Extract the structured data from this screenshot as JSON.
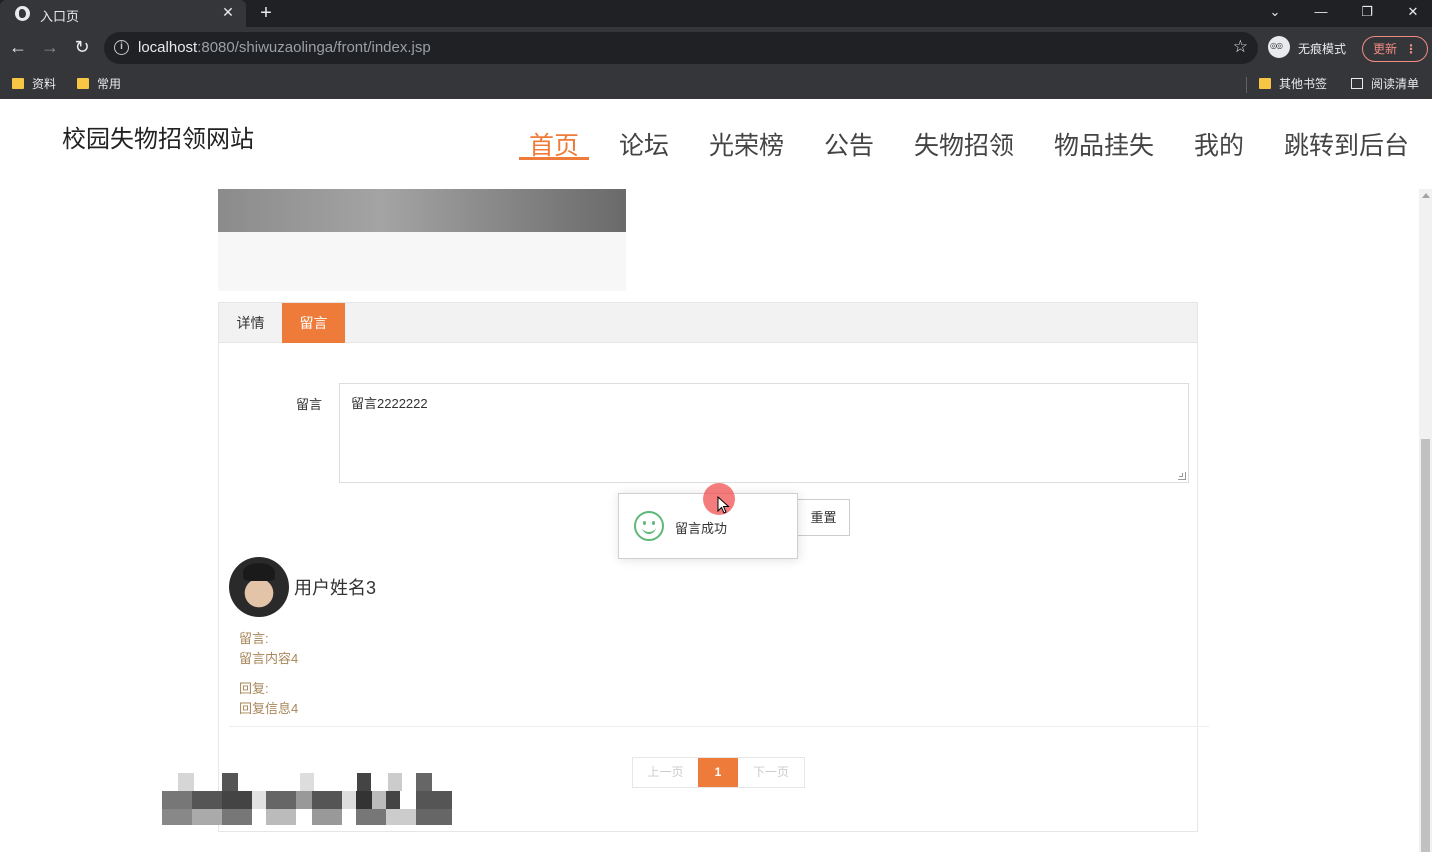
{
  "browser": {
    "tab_title": "入口页",
    "tab_close": "✕",
    "new_tab": "+",
    "win": {
      "chevron": "⌄",
      "minimize": "—",
      "restore": "❐",
      "close": "✕"
    },
    "nav": {
      "back": "←",
      "forward": "→",
      "reload": "↻"
    },
    "url_host": "localhost",
    "url_path": ":8080/shiwuzaolinga/front/index.jsp",
    "star": "☆",
    "incognito_label": "无痕模式",
    "update_label": "更新",
    "update_menu": "⋮",
    "bookmarks": [
      "资料",
      "常用"
    ],
    "bookmarks_right": [
      "其他书签",
      "阅读清单"
    ]
  },
  "site": {
    "title": "校园失物招领网站",
    "nav": [
      "首页",
      "论坛",
      "光荣榜",
      "公告",
      "失物招领",
      "物品挂失",
      "我的",
      "跳转到后台"
    ],
    "active_nav": "首页"
  },
  "panel": {
    "tabs": [
      "详情",
      "留言"
    ],
    "active_tab": "留言",
    "form": {
      "label": "留言",
      "textarea_value": "留言2222222",
      "reset_label": "重置"
    },
    "comment": {
      "username": "用户姓名3",
      "comment_label": "留言:",
      "comment_text": "留言内容4",
      "reply_label": "回复:",
      "reply_text": "回复信息4"
    },
    "pager": {
      "prev": "上一页",
      "current": "1",
      "next": "下一页"
    }
  },
  "toast": {
    "message": "留言成功",
    "icon": "smile-icon"
  },
  "colors": {
    "accent": "#ef7b3a",
    "success": "#5fb878",
    "comment": "#a8875a"
  }
}
